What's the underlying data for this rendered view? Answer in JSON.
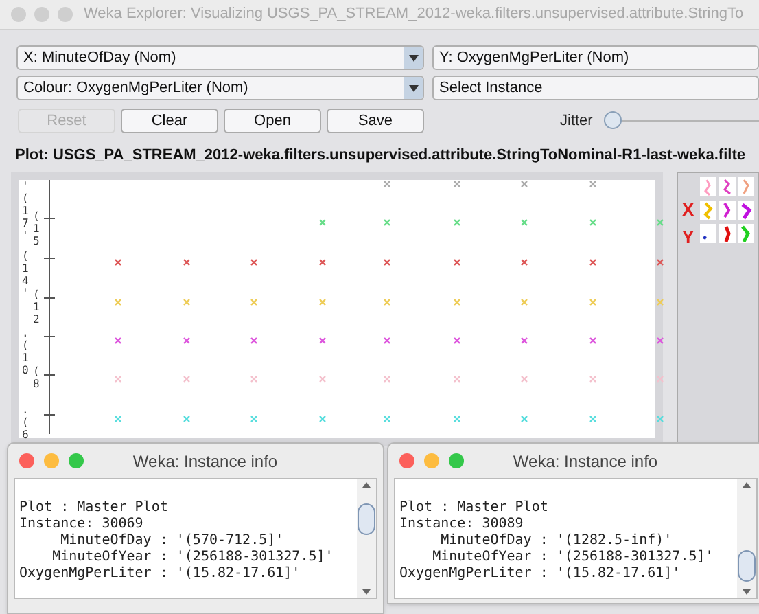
{
  "window": {
    "title": "Weka Explorer: Visualizing USGS_PA_STREAM_2012-weka.filters.unsupervised.attribute.StringTo"
  },
  "selectors": [
    {
      "label": "X: MinuteOfDay (Nom)",
      "dropdown": true
    },
    {
      "label": "Y: OxygenMgPerLiter (Nom)",
      "dropdown": false
    },
    {
      "label": "Colour: OxygenMgPerLiter (Nom)",
      "dropdown": true
    },
    {
      "label": "Select Instance",
      "dropdown": false
    }
  ],
  "buttons": [
    {
      "label": "Reset",
      "disabled": true
    },
    {
      "label": "Clear",
      "disabled": false
    },
    {
      "label": "Open",
      "disabled": false
    },
    {
      "label": "Save",
      "disabled": false
    }
  ],
  "jitter": {
    "label": "Jitter",
    "level": 0
  },
  "plot_title": "Plot: USGS_PA_STREAM_2012-weka.filters.unsupervised.attribute.StringToNominal-R1-last-weka.filte",
  "y_axis_labels": [
    "'(17'",
    "(15",
    "(14'",
    "(12",
    ".(10",
    "(8",
    ".(6"
  ],
  "legend": {
    "x_label": "X",
    "y_label": "Y"
  },
  "instance_windows": [
    {
      "title": "Weka: Instance info",
      "lines": [
        "Plot : Master Plot",
        "Instance: 30069",
        "     MinuteOfDay : '(570-712.5]'",
        "    MinuteOfYear : '(256188-301327.5]'",
        "OxygenMgPerLiter : '(15.82-17.61]'"
      ]
    },
    {
      "title": "Weka: Instance info",
      "lines": [
        "Plot : Master Plot",
        "Instance: 30089",
        "     MinuteOfDay : '(1282.5-inf)'",
        "    MinuteOfYear : '(256188-301327.5]'",
        "OxygenMgPerLiter : '(15.82-17.61]'"
      ]
    }
  ]
}
